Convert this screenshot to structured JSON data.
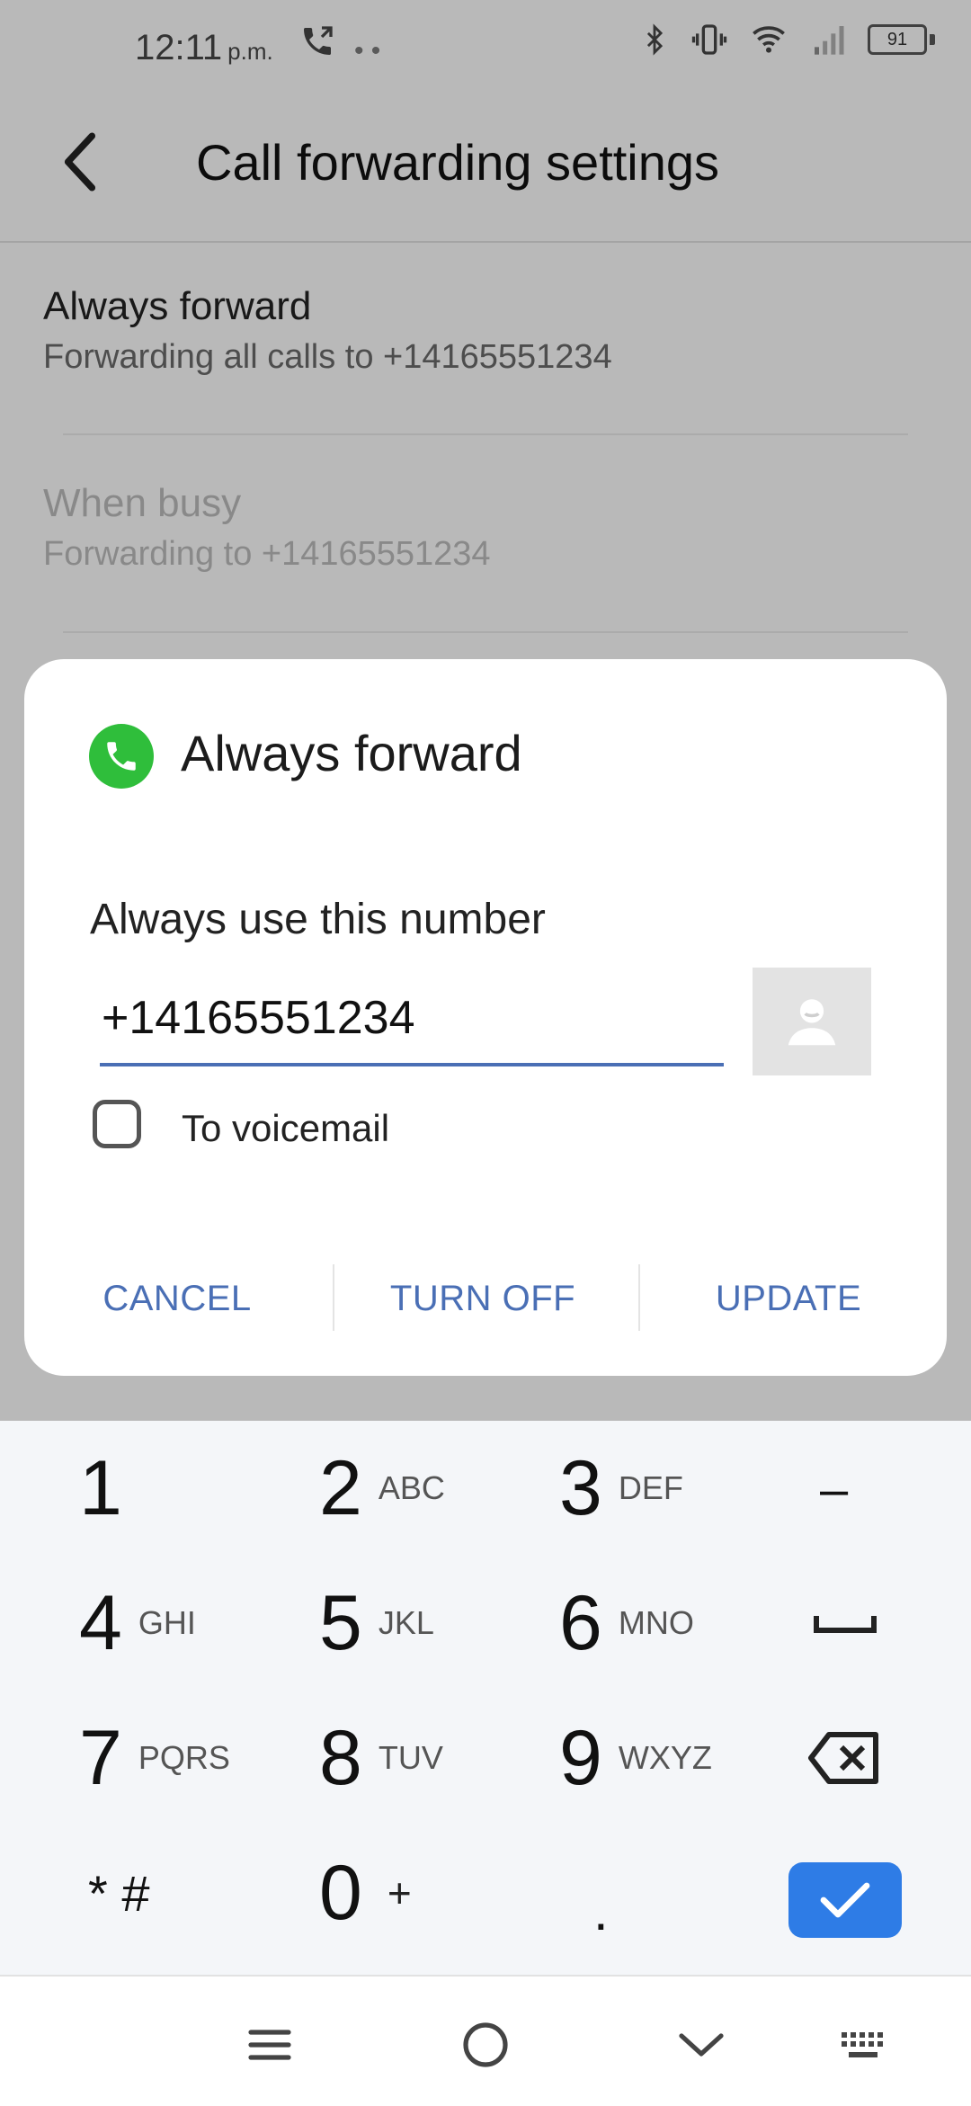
{
  "status_bar": {
    "time": "12:11",
    "ampm": "p.m.",
    "battery": "91",
    "icons": [
      "call-forward-icon",
      "bluetooth-icon",
      "vibrate-icon",
      "wifi-icon",
      "signal-icon",
      "battery-icon"
    ]
  },
  "toolbar": {
    "title": "Call forwarding settings",
    "back_icon": "back-arrow-icon"
  },
  "settings": [
    {
      "title": "Always forward",
      "subtitle": "Forwarding all calls to +14165551234",
      "enabled": true
    },
    {
      "title": "When busy",
      "subtitle": "Forwarding to +14165551234",
      "enabled": false
    }
  ],
  "dialog": {
    "title": "Always forward",
    "icon": "phone-icon",
    "label": "Always use this number",
    "number_value": "+14165551234",
    "contact_icon": "contact-picker-icon",
    "voicemail_label": "To voicemail",
    "voicemail_checked": false,
    "actions": {
      "cancel": "CANCEL",
      "turn_off": "TURN OFF",
      "update": "UPDATE"
    }
  },
  "keypad": {
    "rows": [
      [
        {
          "digit": "1",
          "letters": ""
        },
        {
          "digit": "2",
          "letters": "ABC"
        },
        {
          "digit": "3",
          "letters": "DEF"
        }
      ],
      [
        {
          "digit": "4",
          "letters": "GHI"
        },
        {
          "digit": "5",
          "letters": "JKL"
        },
        {
          "digit": "6",
          "letters": "MNO"
        }
      ],
      [
        {
          "digit": "7",
          "letters": "PQRS"
        },
        {
          "digit": "8",
          "letters": "TUV"
        },
        {
          "digit": "9",
          "letters": "WXYZ"
        }
      ],
      [
        {
          "digit": "* #",
          "letters": ""
        },
        {
          "digit": "0",
          "letters": "+"
        },
        {
          "digit": ".",
          "letters": ""
        }
      ]
    ],
    "side_keys": {
      "minus": "–",
      "space_icon": "space-icon",
      "backspace_icon": "backspace-icon",
      "done_icon": "checkmark-icon"
    }
  },
  "nav_bar": {
    "icons": [
      "menu-icon",
      "home-icon",
      "collapse-icon",
      "keyboard-icon"
    ]
  },
  "colors": {
    "accent": "#4a6fb5",
    "done": "#2e7ce6",
    "phone_green": "#2fbe3b"
  }
}
